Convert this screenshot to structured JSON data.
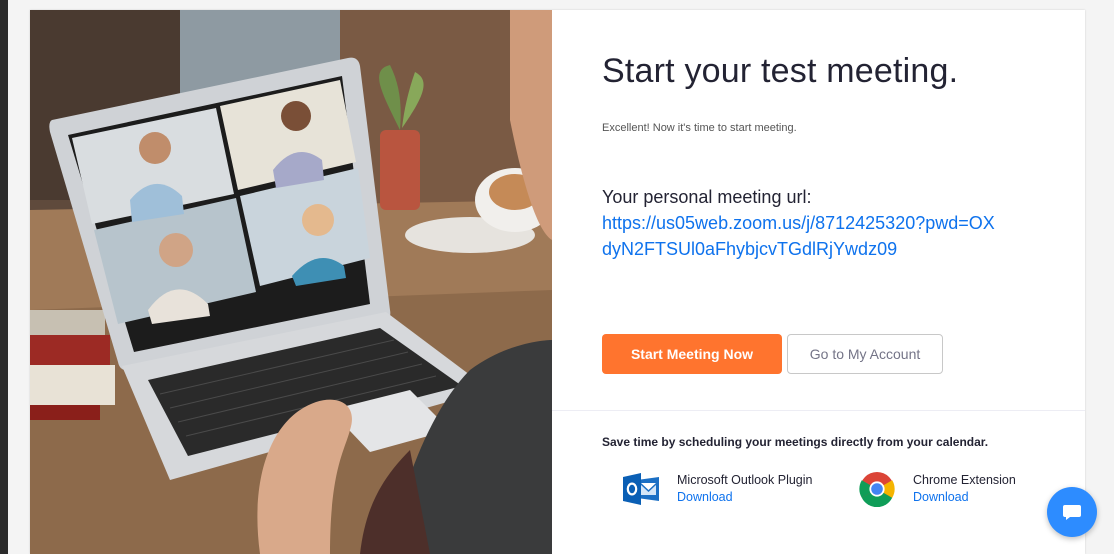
{
  "page": {
    "title": "Start your test meeting.",
    "subtitle": "Excellent! Now it's time to start meeting."
  },
  "meeting": {
    "url_label": "Your personal meeting url:",
    "url": "https://us05web.zoom.us/j/8712425320?pwd=OXdyN2FTSUl0aFhybjcvTGdlRjYwdz09"
  },
  "actions": {
    "start_label": "Start Meeting Now",
    "account_label": "Go to My Account"
  },
  "calendar": {
    "text": "Save time by scheduling your meetings directly from your calendar.",
    "plugins": [
      {
        "name": "Microsoft Outlook Plugin",
        "link": "Download",
        "icon": "outlook-icon"
      },
      {
        "name": "Chrome Extension",
        "link": "Download",
        "icon": "chrome-icon"
      }
    ]
  },
  "hero": {
    "image": "laptop-video-call-photo"
  },
  "chat": {
    "icon": "chat-icon"
  },
  "colors": {
    "accent": "#ff742e",
    "link": "#0e72ed",
    "chat": "#2d8cff",
    "text": "#232333"
  }
}
